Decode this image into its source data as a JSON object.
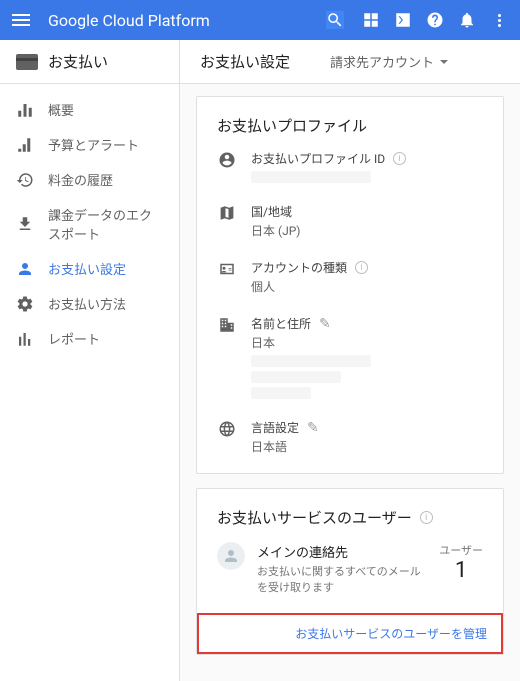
{
  "app_title": "Google Cloud Platform",
  "page": {
    "product": "お支払い",
    "title": "お支払い設定",
    "account_dropdown": "請求先アカウント"
  },
  "sidebar": {
    "items": [
      {
        "label": "概要"
      },
      {
        "label": "予算とアラート"
      },
      {
        "label": "料金の履歴"
      },
      {
        "label": "課金データのエクスポート"
      },
      {
        "label": "お支払い設定"
      },
      {
        "label": "お支払い方法"
      },
      {
        "label": "レポート"
      }
    ]
  },
  "profile_card": {
    "title": "お支払いプロファイル",
    "fields": {
      "profile_id": {
        "label": "お支払いプロファイル ID"
      },
      "country": {
        "label": "国/地域",
        "value": "日本 (JP)"
      },
      "account_type": {
        "label": "アカウントの種類",
        "value": "個人"
      },
      "name_address": {
        "label": "名前と住所",
        "value": "日本"
      },
      "language": {
        "label": "言語設定",
        "value": "日本語"
      }
    }
  },
  "users_card": {
    "title": "お支払いサービスのユーザー",
    "primary_contact": "メインの連絡先",
    "description": "お支払いに関するすべてのメールを受け取ります",
    "count_label": "ユーザー",
    "count": "1",
    "manage_link": "お支払いサービスのユーザーを管理"
  }
}
